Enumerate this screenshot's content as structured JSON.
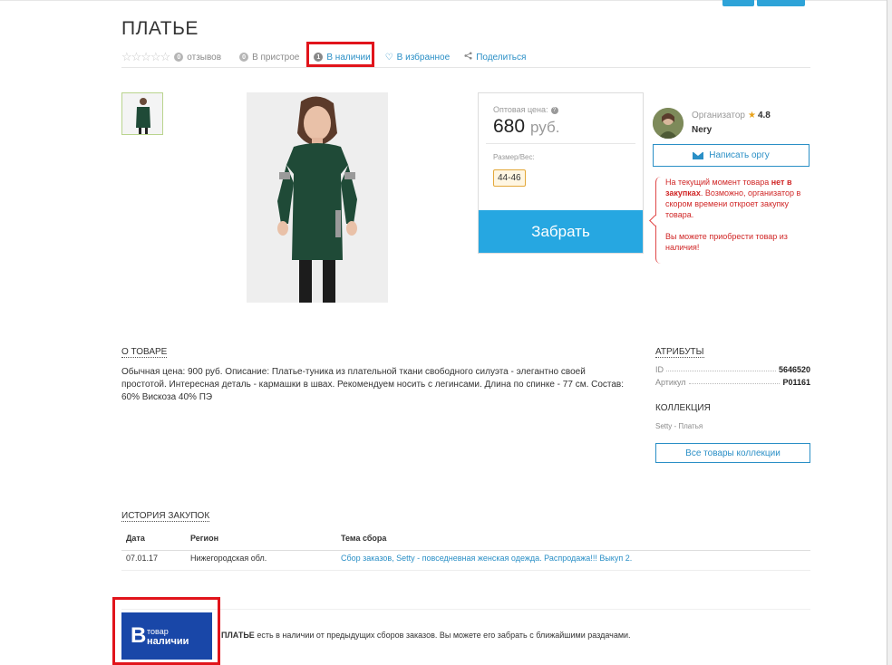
{
  "product": {
    "title": "ПЛАТЬЕ",
    "stars": "☆☆☆☆☆",
    "reviews_count": "0",
    "reviews_label": "отзывов",
    "pristroy_count": "0",
    "pristroy_label": "В пристрое",
    "stock_count": "1",
    "stock_label": "В наличии",
    "favorite_label": "В избранное",
    "share_label": "Поделиться"
  },
  "price": {
    "label": "Оптовая цена:",
    "value": "680",
    "currency": "руб.",
    "size_label": "Размер/Вес:",
    "size_value": "44-46",
    "buy_label": "Забрать"
  },
  "organizer": {
    "label": "Организатор",
    "rating": "4.8",
    "name": "Nery",
    "message_button": "Написать оргу"
  },
  "notice": {
    "line1_pre": "На текущий момент товара ",
    "line1_bold": "нет в закупках",
    "line1_post": ". Возможно, организатор в скором времени откроет закупку товара.",
    "line2": "Вы можете приобрести товар из наличия!"
  },
  "about": {
    "heading": "О ТОВАРЕ",
    "text": "Обычная цена: 900 руб. Описание: Платье-туника из плательной ткани свободного силуэта - элегантно своей простотой. Интересная деталь - кармашки в швах. Рекомендуем носить с легинсами. Длина по спинке - 77 см. Состав: 60% Вискоза 40% ПЭ"
  },
  "attributes": {
    "heading": "АТРИБУТЫ",
    "rows": [
      {
        "label": "ID",
        "value": "5646520"
      },
      {
        "label": "Артикул",
        "value": "P01161"
      }
    ],
    "collection_heading": "КОЛЛЕКЦИЯ",
    "collection_value": "Setty - Платья",
    "collection_button": "Все товары коллекции"
  },
  "history": {
    "heading": "ИСТОРИЯ ЗАКУПОК",
    "columns": [
      "Дата",
      "Регион",
      "Тема сбора"
    ],
    "rows": [
      {
        "date": "07.01.17",
        "region": "Нижегородская обл.",
        "topic": "Сбор заказов, Setty - повседневная женская одежда. Распродажа!!! Выкуп 2."
      }
    ]
  },
  "stock_badge": {
    "big": "В",
    "small1": "товар",
    "small2": "наличии"
  },
  "bottom": {
    "bold": "ПЛАТЬЕ",
    "text": " есть в наличии от предыдущих сборов заказов. Вы можете его забрать с ближайшими раздачами."
  },
  "colors": {
    "accent": "#26a7e1",
    "link": "#2a8fc6",
    "warning": "#d02626",
    "highlight_box": "#e1141b",
    "badge_bg": "#1947a8"
  }
}
